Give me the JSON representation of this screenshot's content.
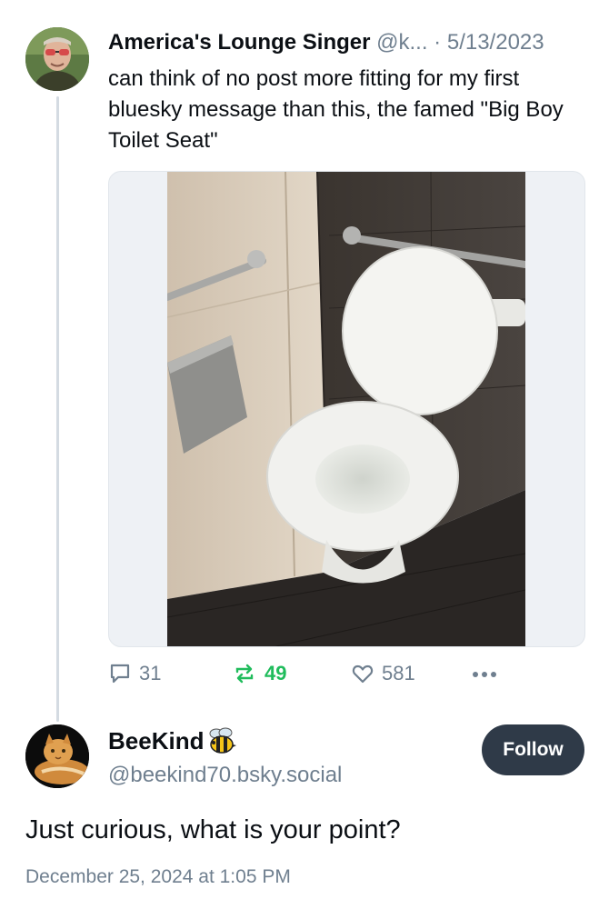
{
  "post": {
    "author_name": "America's Lounge Singer",
    "author_handle": "@k...",
    "separator": "·",
    "date": "5/13/2023",
    "text": "can think of no post more fitting for my first bluesky message than this, the famed \"Big Boy Toilet Seat\"",
    "image_subject": "photo of a large white toilet with oversized seat in a tiled restroom stall"
  },
  "actions": {
    "reply_count": "31",
    "repost_count": "49",
    "like_count": "581",
    "reply_icon": "speech-bubble-icon",
    "repost_icon": "repost-arrows-icon",
    "like_icon": "heart-icon",
    "more_icon": "ellipsis-icon"
  },
  "reply": {
    "author_name": "BeeKind",
    "emoji_icon": "bee-icon",
    "author_handle": "@beekind70.bsky.social",
    "follow_label": "Follow",
    "text": "Just curious, what is your point?",
    "timestamp": "December 25, 2024 at 1:05 PM"
  },
  "colors": {
    "repost_active": "#20bc5c",
    "muted": "#6f7f8f",
    "follow_button": "#2f3a48",
    "thread_line": "#d4dbe2"
  }
}
